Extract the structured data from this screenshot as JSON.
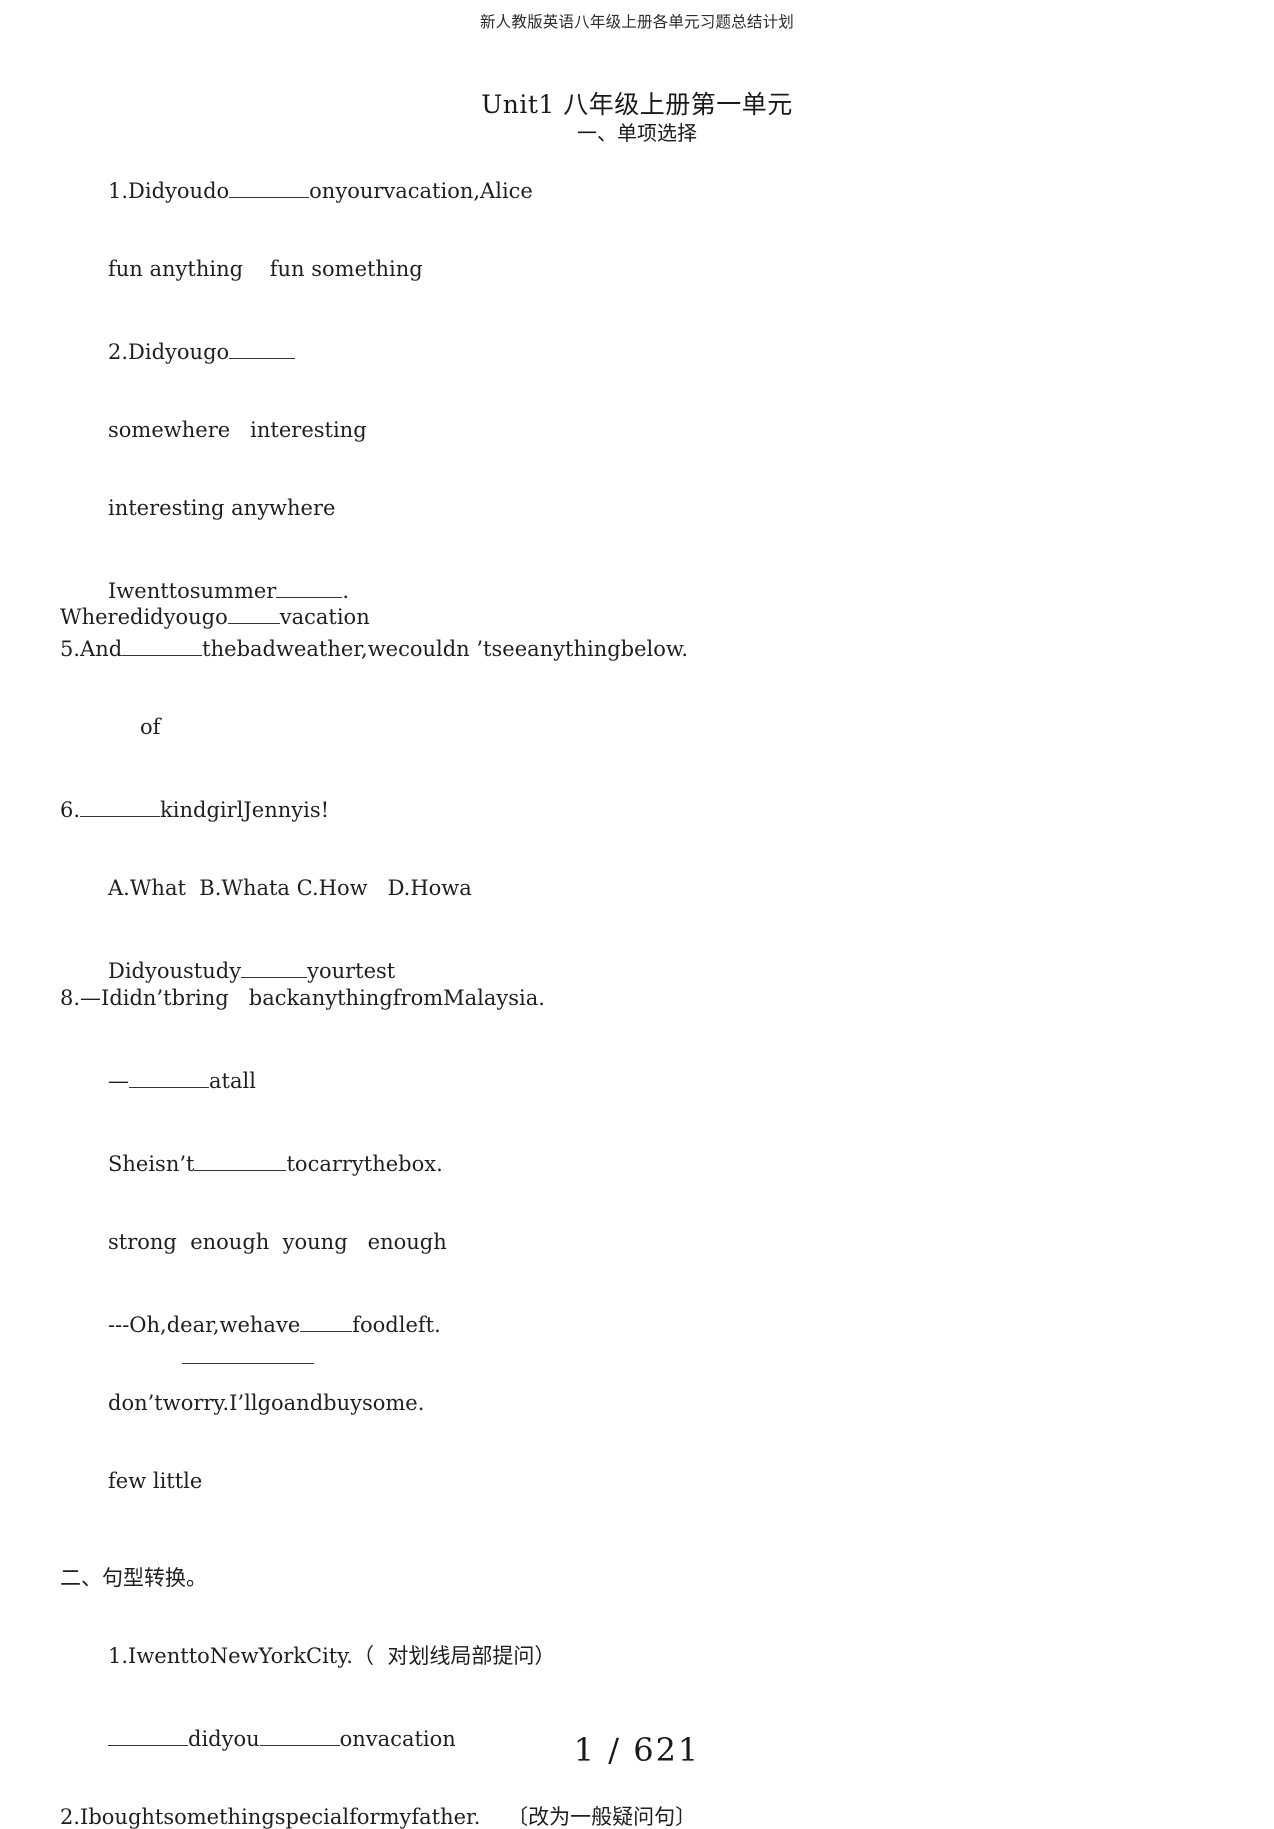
{
  "header": {
    "running_title": "新人教版英语八年级上册各单元习题总结计划"
  },
  "title": {
    "main": "Unit1 八年级上册第一单元",
    "sub": "一、单项选择"
  },
  "lines": {
    "q1": "1.Didyoudo",
    "q1_tail": "onyourvacation,Alice",
    "q1_options": "fun anything    fun something",
    "q2": "2.Didyougo",
    "q2_options_a": "somewhere   interesting",
    "q2_options_b": "interesting anywhere",
    "q3": "Iwenttosummer",
    "q3_tail": ".",
    "q4": "Wheredidyougo",
    "q4_tail": "vacation",
    "q5": "5.And",
    "q5_tail": "thebadweather,wecouldn ’tseeanythingbelow.",
    "q5_option": "of",
    "q6": "6.",
    "q6_tail": "kindgirlJennyis!",
    "q6_options": "A.What  B.Whata C.How   D.Howa",
    "q7": "Didyoustudy",
    "q7_tail": "yourtest",
    "q8": "8.—Ididn’tbring   backanythingfromMalaysia.",
    "q8_answer": "—",
    "q8_answer_tail": "atall",
    "q9": "Sheisn’t",
    "q9_tail": "tocarrythebox.",
    "q9_options": "strong  enough  young   enough",
    "q10": "---Oh,dear,wehave",
    "q10_tail": "foodleft.",
    "q10_reply": "don’tworry.I’llgoandbuysome.",
    "q10_options": "few little",
    "section2": "二、句型转换。",
    "s2q1": "1.IwenttoNewYorkCity.（  对划线局部提问）",
    "s2q1_ans_a": "didyou",
    "s2q1_ans_b": "onvacation",
    "s2q2": "2.Iboughtsomethingspecialformyfather.    〔改为一般疑问句〕"
  },
  "footer": {
    "page": "1 / 621"
  }
}
